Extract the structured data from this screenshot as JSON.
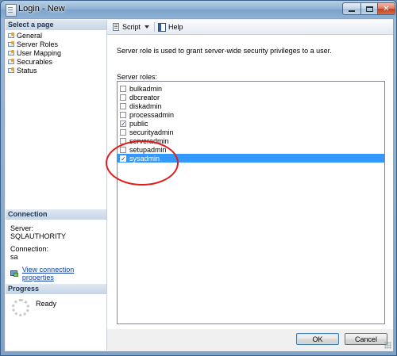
{
  "window": {
    "title": "Login - New"
  },
  "left_pane": {
    "select_page_header": "Select a page",
    "pages": [
      {
        "label": "General"
      },
      {
        "label": "Server Roles"
      },
      {
        "label": "User Mapping"
      },
      {
        "label": "Securables"
      },
      {
        "label": "Status"
      }
    ],
    "connection_header": "Connection",
    "server_label": "Server:",
    "server_value": "SQLAUTHORITY",
    "connection_label": "Connection:",
    "connection_value": "sa",
    "view_connection_link": "View connection properties",
    "progress_header": "Progress",
    "progress_status": "Ready"
  },
  "toolbar": {
    "script_label": "Script",
    "help_label": "Help"
  },
  "main": {
    "description": "Server role is used to grant server-wide security privileges to a user.",
    "roles_label": "Server roles:",
    "roles": [
      {
        "name": "bulkadmin",
        "checked": false,
        "selected": false
      },
      {
        "name": "dbcreator",
        "checked": false,
        "selected": false
      },
      {
        "name": "diskadmin",
        "checked": false,
        "selected": false
      },
      {
        "name": "processadmin",
        "checked": false,
        "selected": false
      },
      {
        "name": "public",
        "checked": true,
        "selected": false
      },
      {
        "name": "securityadmin",
        "checked": false,
        "selected": false
      },
      {
        "name": "serveradmin",
        "checked": false,
        "selected": false
      },
      {
        "name": "setupadmin",
        "checked": false,
        "selected": false
      },
      {
        "name": "sysadmin",
        "checked": true,
        "selected": true
      }
    ]
  },
  "buttons": {
    "ok_label": "OK",
    "cancel_label": "Cancel"
  },
  "colors": {
    "selection": "#3399ff",
    "annotation": "#e41b1b",
    "link": "#0b3ca8"
  }
}
